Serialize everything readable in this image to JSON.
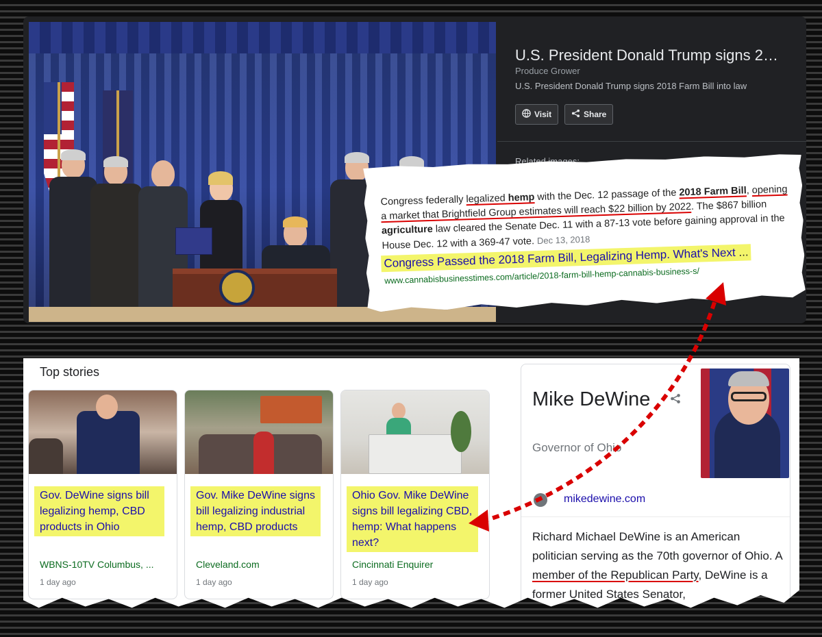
{
  "top_panel": {
    "title": "U.S. President Donald Trump signs 2…",
    "source": "Produce Grower",
    "description": "U.S. President Donald Trump signs 2018 Farm Bill into law",
    "visit_label": "Visit",
    "share_label": "Share",
    "related_label": "Related images:"
  },
  "snippet": {
    "p1": "Congress federally ",
    "p2": "legalized ",
    "p3": "hemp",
    "p4": " with the Dec. 12 passage of the ",
    "p5": "2018 Farm Bill",
    "p6": ",",
    "p7": "opening a market that Brightfield Group estimates will reach $22 billion by 2022",
    "p8": ". The $867 billion ",
    "p9": "agriculture",
    "p10": " law cleared the Senate Dec. 11 with a 87-13 vote before gaining approval in the House Dec. 12 with a 369-47 vote.",
    "date": "Dec 13, 2018",
    "link_title": "Congress Passed the 2018 Farm Bill, Legalizing Hemp. What's Next",
    "link_ellipsis": " ...",
    "url": "www.cannabisbusinesstimes.com/article/2018-farm-bill-hemp-cannabis-business-s/"
  },
  "top_stories": {
    "title": "Top stories",
    "cards": [
      {
        "title": "Gov. DeWine signs bill legalizing hemp, CBD products in Ohio",
        "source": "WBNS-10TV Columbus, ...",
        "age": "1 day ago"
      },
      {
        "title": "Gov. Mike DeWine signs bill legalizing industrial hemp, CBD products",
        "source": "Cleveland.com",
        "age": "1 day ago"
      },
      {
        "title": "Ohio Gov. Mike DeWine signs bill legalizing CBD, hemp: What happens next?",
        "source": "Cincinnati Enquirer",
        "age": "1 day ago"
      }
    ]
  },
  "knowledge_panel": {
    "name": "Mike DeWine",
    "subtitle": "Governor of Ohio",
    "website": "mikedewine.com",
    "desc1": "Richard Michael DeWine is an American politician serving as the 70th governor of Ohio. A ",
    "desc2": "member of the Republican Party",
    "desc3": ", DeWine is a former United States Senator,"
  },
  "colors": {
    "highlight": "#f3f56b",
    "annotation_red": "#d90000",
    "link_blue": "#1a0dab",
    "source_green": "#0b6b1f"
  }
}
